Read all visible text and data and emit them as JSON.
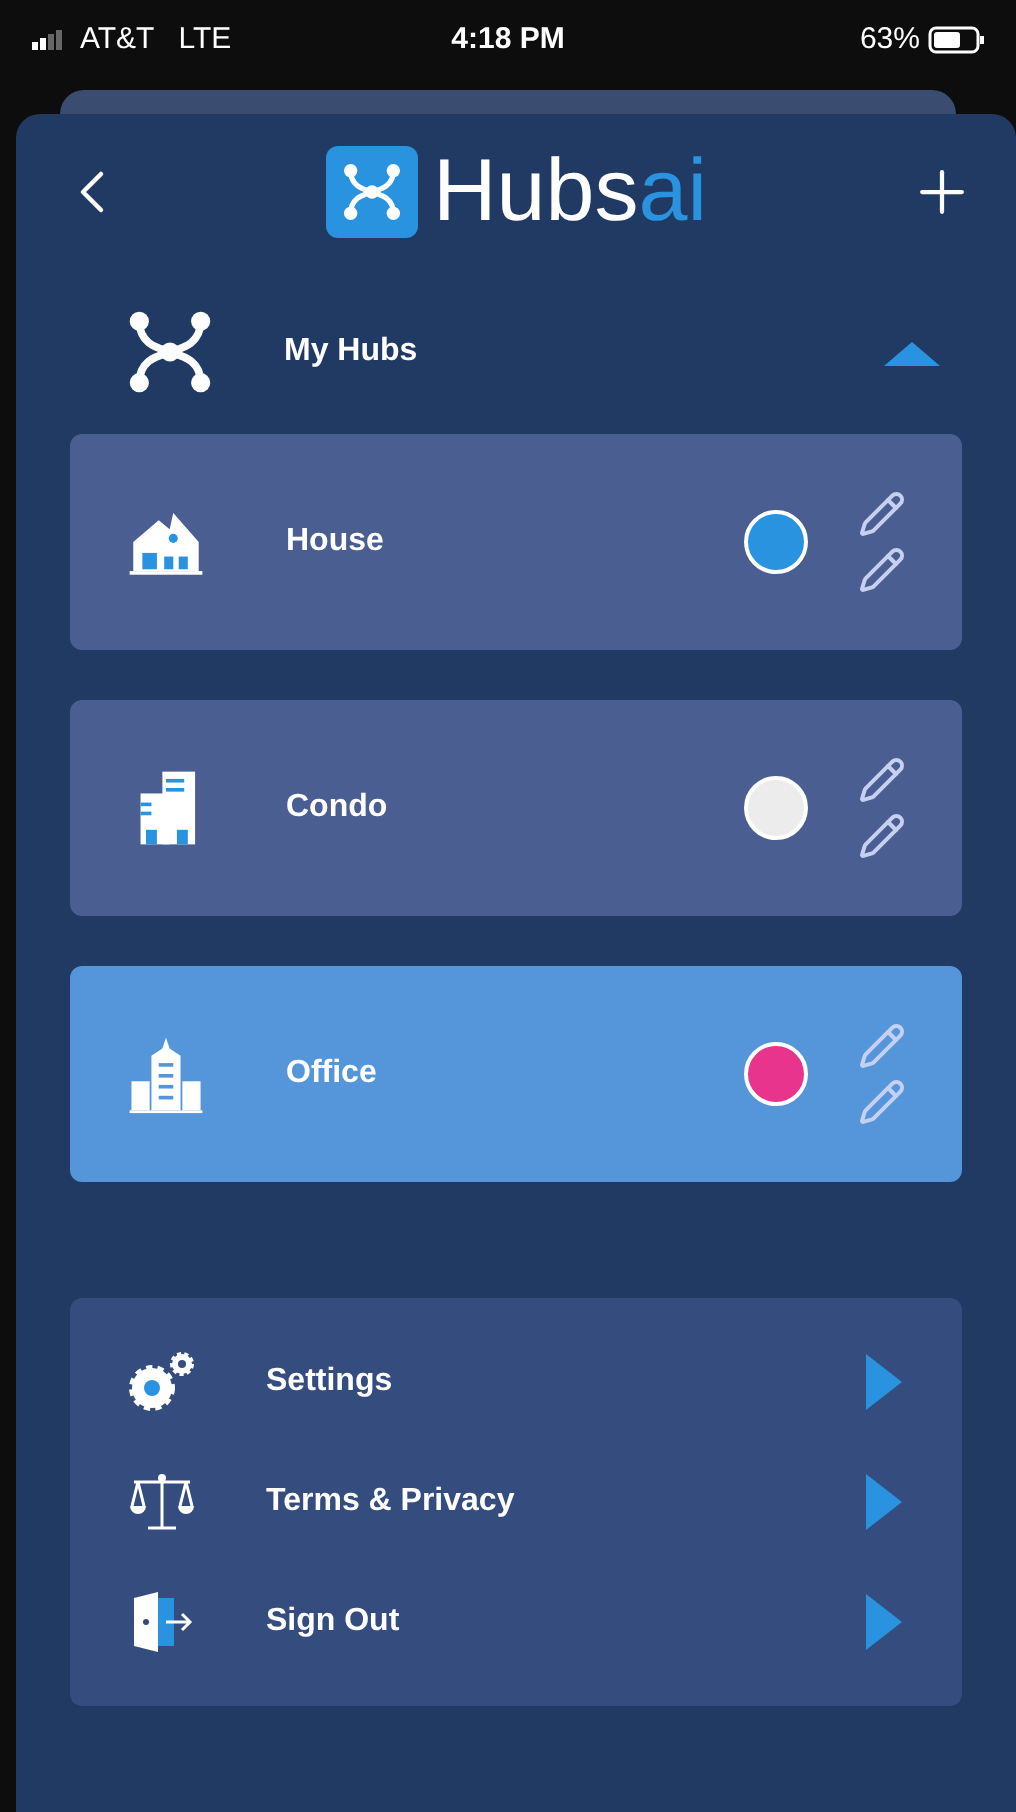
{
  "status_bar": {
    "carrier": "AT&T",
    "network": "LTE",
    "time": "4:18 PM",
    "battery": "63%"
  },
  "header": {
    "logo_main": "Hubs",
    "logo_accent": "ai"
  },
  "section": {
    "title": "My Hubs",
    "expanded": true
  },
  "hubs": [
    {
      "name": "House",
      "kind": "house",
      "color": "#2a93e0",
      "selected": false
    },
    {
      "name": "Condo",
      "kind": "condo",
      "color": "#ececec",
      "selected": false
    },
    {
      "name": "Office",
      "kind": "office",
      "color": "#e8348c",
      "selected": true
    }
  ],
  "menu": [
    {
      "label": "Settings",
      "kind": "settings"
    },
    {
      "label": "Terms & Privacy",
      "kind": "terms"
    },
    {
      "label": "Sign Out",
      "kind": "signout"
    }
  ]
}
